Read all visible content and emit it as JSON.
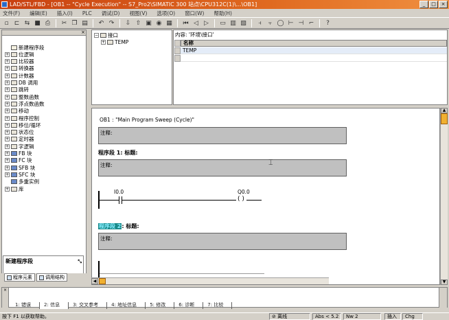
{
  "window": {
    "title": "LAD/STL/FBD - [OB1 -- \"Cycle Execution\" -- S7_Pro2\\SIMATIC 300 站点\\CPU312C(1)\\...\\OB1]"
  },
  "menu": [
    "文件(F)",
    "编辑(E)",
    "插入(I)",
    "PLC",
    "调试(D)",
    "视图(V)",
    "选项(O)",
    "窗口(W)",
    "帮助(H)"
  ],
  "left_tree": {
    "items": [
      {
        "label": "新建程序段",
        "icon": "new-network-icon",
        "expandable": false
      },
      {
        "label": "位逻辑",
        "icon": "folder-icon",
        "expandable": true
      },
      {
        "label": "比较器",
        "icon": "folder-icon",
        "expandable": true
      },
      {
        "label": "转换器",
        "icon": "folder-icon",
        "expandable": true
      },
      {
        "label": "计数器",
        "icon": "folder-icon",
        "expandable": true
      },
      {
        "label": "DB 调用",
        "icon": "folder-icon",
        "expandable": true
      },
      {
        "label": "跳转",
        "icon": "folder-icon",
        "expandable": true
      },
      {
        "label": "整数函数",
        "icon": "folder-icon",
        "expandable": true
      },
      {
        "label": "浮点数函数",
        "icon": "folder-icon",
        "expandable": true
      },
      {
        "label": "移动",
        "icon": "folder-icon",
        "expandable": true
      },
      {
        "label": "程序控制",
        "icon": "folder-icon",
        "expandable": true
      },
      {
        "label": "移位/循环",
        "icon": "folder-icon",
        "expandable": true
      },
      {
        "label": "状态位",
        "icon": "folder-icon",
        "expandable": true
      },
      {
        "label": "定时器",
        "icon": "folder-icon",
        "expandable": true
      },
      {
        "label": "字逻辑",
        "icon": "folder-icon",
        "expandable": true
      },
      {
        "label": "FB 块",
        "icon": "block-icon",
        "expandable": true
      },
      {
        "label": "FC 块",
        "icon": "block-icon",
        "expandable": true
      },
      {
        "label": "SFB 块",
        "icon": "block-icon",
        "expandable": true
      },
      {
        "label": "SFC 块",
        "icon": "block-icon",
        "expandable": true
      },
      {
        "label": "多重实例",
        "icon": "multi-instance-icon",
        "expandable": false
      },
      {
        "label": "库",
        "icon": "library-icon",
        "expandable": true
      }
    ],
    "info_title": "新建程序段",
    "tabs": [
      "程序元素",
      "调用结构"
    ]
  },
  "decl": {
    "tree_root": "接口",
    "tree_child": "TEMP",
    "content_label": "内容: '环境\\接口'",
    "col_name": "名称",
    "rows": [
      "TEMP",
      ""
    ]
  },
  "editor": {
    "block_title": "OB1 :   \"Main Program Sweep (Cycle)\"",
    "comment_label": "注释:",
    "network1": {
      "prefix": "程序段",
      "number": "1",
      "title": ": 标题:"
    },
    "contact_addr": "I0.0",
    "coil_addr": "Q0.0",
    "network2": {
      "prefix": "程序段",
      "number": "2",
      "title": ": 标题:"
    }
  },
  "bottom_tabs": [
    "1: 错误",
    "2: 信息",
    "3: 交叉参考",
    "4: 地址信息",
    "5: 修改",
    "6: 诊断",
    "7: 比较"
  ],
  "status": {
    "help": "按下 F1 以获取帮助。",
    "mode": "离线",
    "position": "Abs < 5.2",
    "network": "Nw 2",
    "insert": "插入",
    "chg": "Chg"
  }
}
